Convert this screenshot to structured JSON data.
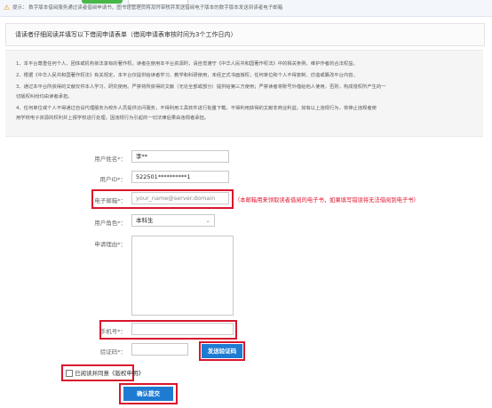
{
  "notice": {
    "text": "提示：  数字版本借阅服务通过读者借阅申请书，图书馆管理员将及时审核并发送借阅电子版本的数字版本发送到读者电子邮箱"
  },
  "form_title": "请读者仔细阅读并填写以下借阅申请表单（借阅申请表审核时间为3个工作日内）",
  "rules": [
    "1、本平台尊重任何个人、团体或机构依法享有的著作权，读者在使用本平台资源时，请自觉遵守《中华人民共和国著作权法》中的相关条例，维护作者的合法权益。",
    "2、根据《中华人民共和国著作权法》有关规定，本平台仅提供给读者学习、教学和科研使用，未经正式书面授权，任何单位和个人不得复制、仿造或篡改平台内容。",
    "3、通过本平台所获得的文献仅供本人学习、研究使用。严禁将所获得的文献（无论全部或部分）提供给第三方使用；严禁读者将账号外借给他人使用，否则，构成侵权所产生的一",
    "切版权纠纷均由读者承担。",
    "4、任何单位或个人不得通过自设代理服务为校外人员提供访问服务，不得利用工具软件进行批量下载，不得利用获得的文献非商业利益。如有以上违规行为，将停止违规者使",
    "用学校电子资源的权利并上报学校进行处理，因违规行为引起的一切法律后果由违规者承担。"
  ],
  "fields": {
    "name_label": "用户姓名*：",
    "name_value": "李**",
    "id_label": "用户ID*：",
    "id_value": "522501**********1",
    "email_label": "电子邮箱*：",
    "email_placeholder": "your_name@server.domain",
    "email_hint": "（本邮箱用来领取读者借阅的电子书，如果填写错误将无法借阅到电子书）",
    "role_label": "用户角色*：",
    "role_value": "本科生",
    "reason_label": "申请理由*：",
    "reason_value": "",
    "phone_label": "手机号*：",
    "phone_value": "",
    "code_label": "验证码*：",
    "code_value": "",
    "send_code_button": "发送验证码",
    "agree_label": "已阅读并同意《版权申明》",
    "submit_button": "确认提交"
  },
  "colors": {
    "highlight_border": "#d9162d",
    "button_blue": "#1e7bd2",
    "hint_red": "#e0142e"
  }
}
